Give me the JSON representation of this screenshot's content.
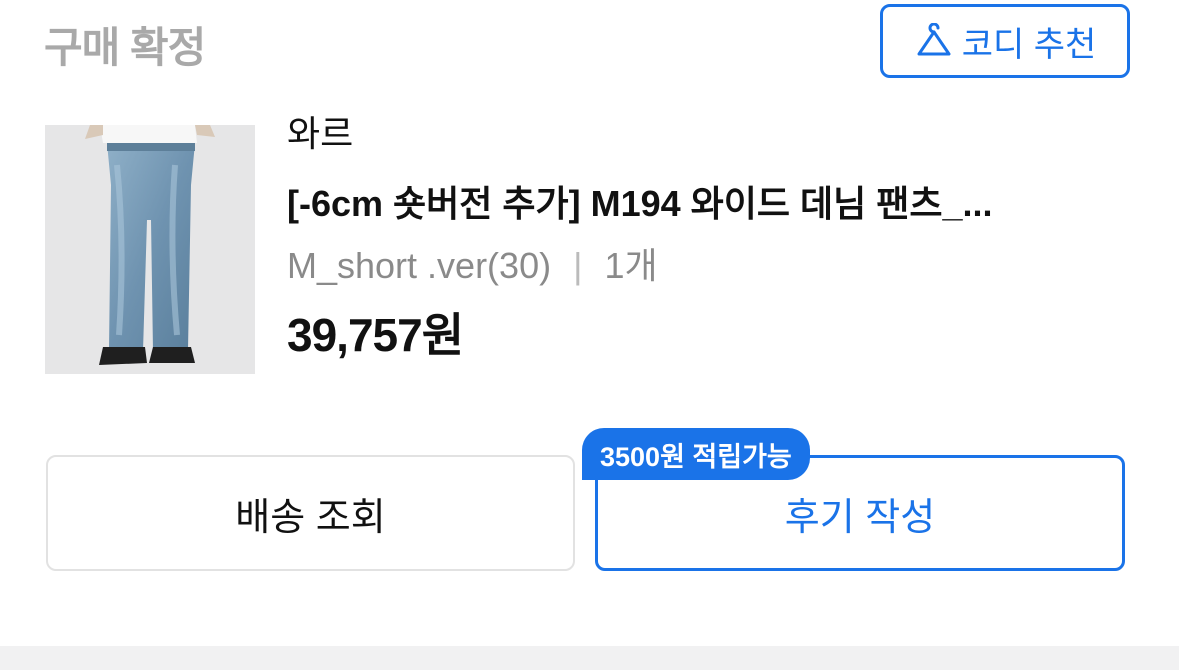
{
  "header": {
    "status_title": "구매 확정",
    "coordi_button": {
      "label": "코디 추천",
      "icon": "hanger-icon"
    }
  },
  "product": {
    "brand": "와르",
    "name": "[-6cm 숏버전 추가] M194 와이드 데님 팬츠_...",
    "option": "M_short .ver(30)",
    "separator": "|",
    "quantity": "1개",
    "price": "39,757원"
  },
  "actions": {
    "shipping_label": "배송 조회",
    "review_label": "후기 작성",
    "review_badge": "3500원 적립가능"
  },
  "colors": {
    "accent": "#1a73e8",
    "muted_text": "#8a8a8a",
    "status_text": "#a9a9a9",
    "border": "#e2e2e2"
  }
}
